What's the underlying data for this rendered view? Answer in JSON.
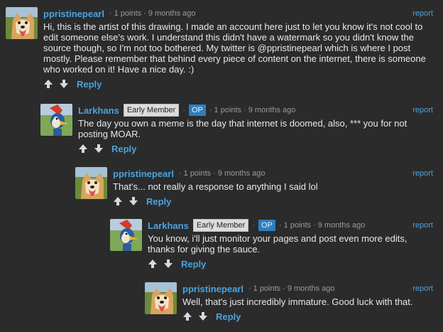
{
  "comments": [
    {
      "username": "ppristinepearl",
      "points": "1 points",
      "time": "9 months ago",
      "report": "report",
      "text": "Hi, this is the artist of this drawing. I made an account here just to let you know it's not cool to edit someone else's work. I understand this didn't have a watermark so you didn't know the source though, so I'm not too bothered. My twitter is @ppristinepearl which is where I post mostly. Please remember that behind every piece of content on the internet, there is someone who worked on it! Have a nice day. :)",
      "reply": "Reply",
      "avatar": "dog-avatar"
    },
    {
      "username": "Larkhans",
      "badge_member": "Early Member",
      "badge_op": "OP",
      "points": "1 points",
      "time": "9 months ago",
      "report": "report",
      "text": "The day you own a meme is the day that internet is doomed, also, *** you for not posting MOAR.",
      "reply": "Reply",
      "avatar": "woodpecker-avatar"
    },
    {
      "username": "ppristinepearl",
      "points": "1 points",
      "time": "9 months ago",
      "report": "report",
      "text": "That's... not really a response to anything I said lol",
      "reply": "Reply",
      "avatar": "dog-avatar"
    },
    {
      "username": "Larkhans",
      "badge_member": "Early Member",
      "badge_op": "OP",
      "points": "1 points",
      "time": "9 months ago",
      "report": "report",
      "text": "You know, i'll just monitor your pages and post even more edits, thanks for giving the sauce.",
      "reply": "Reply",
      "avatar": "woodpecker-avatar"
    },
    {
      "username": "ppristinepearl",
      "points": "1 points",
      "time": "9 months ago",
      "report": "report",
      "text": "Well, that's just incredibly immature. Good luck with that.",
      "reply": "Reply",
      "avatar": "dog-avatar"
    }
  ],
  "colors": {
    "background": "#2b2b2b",
    "link": "#4aa3df",
    "op_badge": "#2c7fc0",
    "member_badge": "#dcdcdc"
  }
}
